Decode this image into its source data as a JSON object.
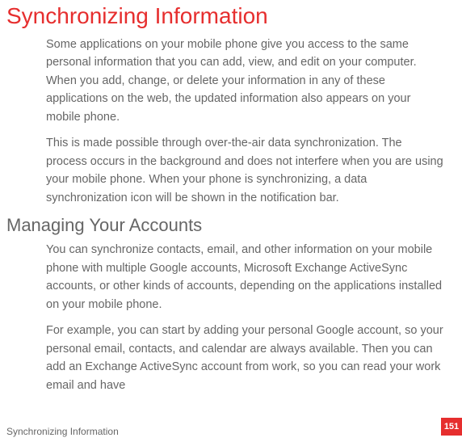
{
  "headings": {
    "main": "Synchronizing Information",
    "sub": "Managing Your Accounts"
  },
  "paragraphs": {
    "p1": "Some applications on your mobile phone give you access to the same personal information that you can add, view, and edit on your computer. When you add, change, or delete your information in any of these applications on the web, the updated information also appears on your mobile phone.",
    "p2": "This is made possible through over-the-air data synchronization. The process occurs in the background and does not interfere when you are using your mobile phone. When your phone is synchronizing, a data synchronization icon will be shown in the notification bar.",
    "p3": "You can synchronize contacts, email, and other information on your mobile phone with multiple Google accounts, Microsoft Exchange ActiveSync accounts, or other kinds of accounts, depending on the applications installed on your mobile phone.",
    "p4": "For example, you can start by adding your personal Google account, so your personal email, contacts, and calendar are always available. Then you can add an Exchange ActiveSync account from work, so you can read your work email and have"
  },
  "footer": "Synchronizing Information",
  "page_number": "151"
}
